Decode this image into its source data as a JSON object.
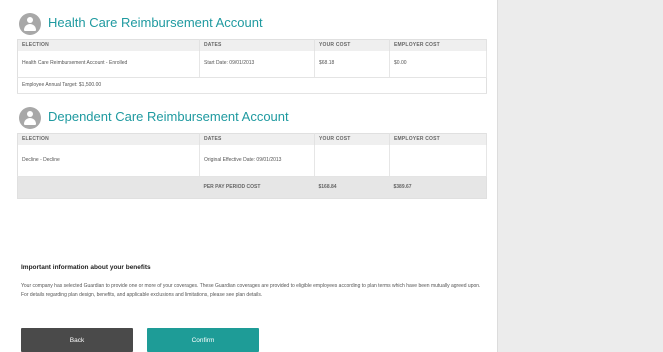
{
  "sections": [
    {
      "title": "Health Care Reimbursement Account",
      "columns": [
        "ELECTION",
        "DATES",
        "YOUR COST",
        "EMPLOYER COST"
      ],
      "row": {
        "election": "Health Care Reimbursement Account - Enrolled",
        "dates": "Start Date: 09/01/2013",
        "your_cost": "$68.18",
        "employer_cost": "$0.00"
      },
      "annual_target": "Employee Annual Target: $1,500.00"
    },
    {
      "title": "Dependent Care Reimbursement Account",
      "columns": [
        "ELECTION",
        "DATES",
        "YOUR COST",
        "EMPLOYER COST"
      ],
      "row": {
        "election": "Decline - Decline",
        "dates": "Original Effective Date: 09/01/2013",
        "your_cost": "",
        "employer_cost": ""
      }
    }
  ],
  "totals": {
    "label": "PER PAY PERIOD COST",
    "your_cost": "$168.84",
    "employer_cost": "$389.67"
  },
  "info": {
    "heading": "Important information about your benefits",
    "text": "Your company has selected Guardian to provide one or more of your coverages. These Guardian coverages are provided to eligible employees according to plan terms which have been mutually agreed upon. For details regarding plan design, benefits, and applicable exclusions and limitations, please see plan details."
  },
  "buttons": {
    "back": "Back",
    "confirm": "Confirm"
  },
  "colors": {
    "accent": "#1f9aa0",
    "confirm": "#1e9c97",
    "back": "#4a4a4a",
    "side_panel": "#ececec"
  },
  "icons": [
    "user-icon",
    "user-icon"
  ]
}
